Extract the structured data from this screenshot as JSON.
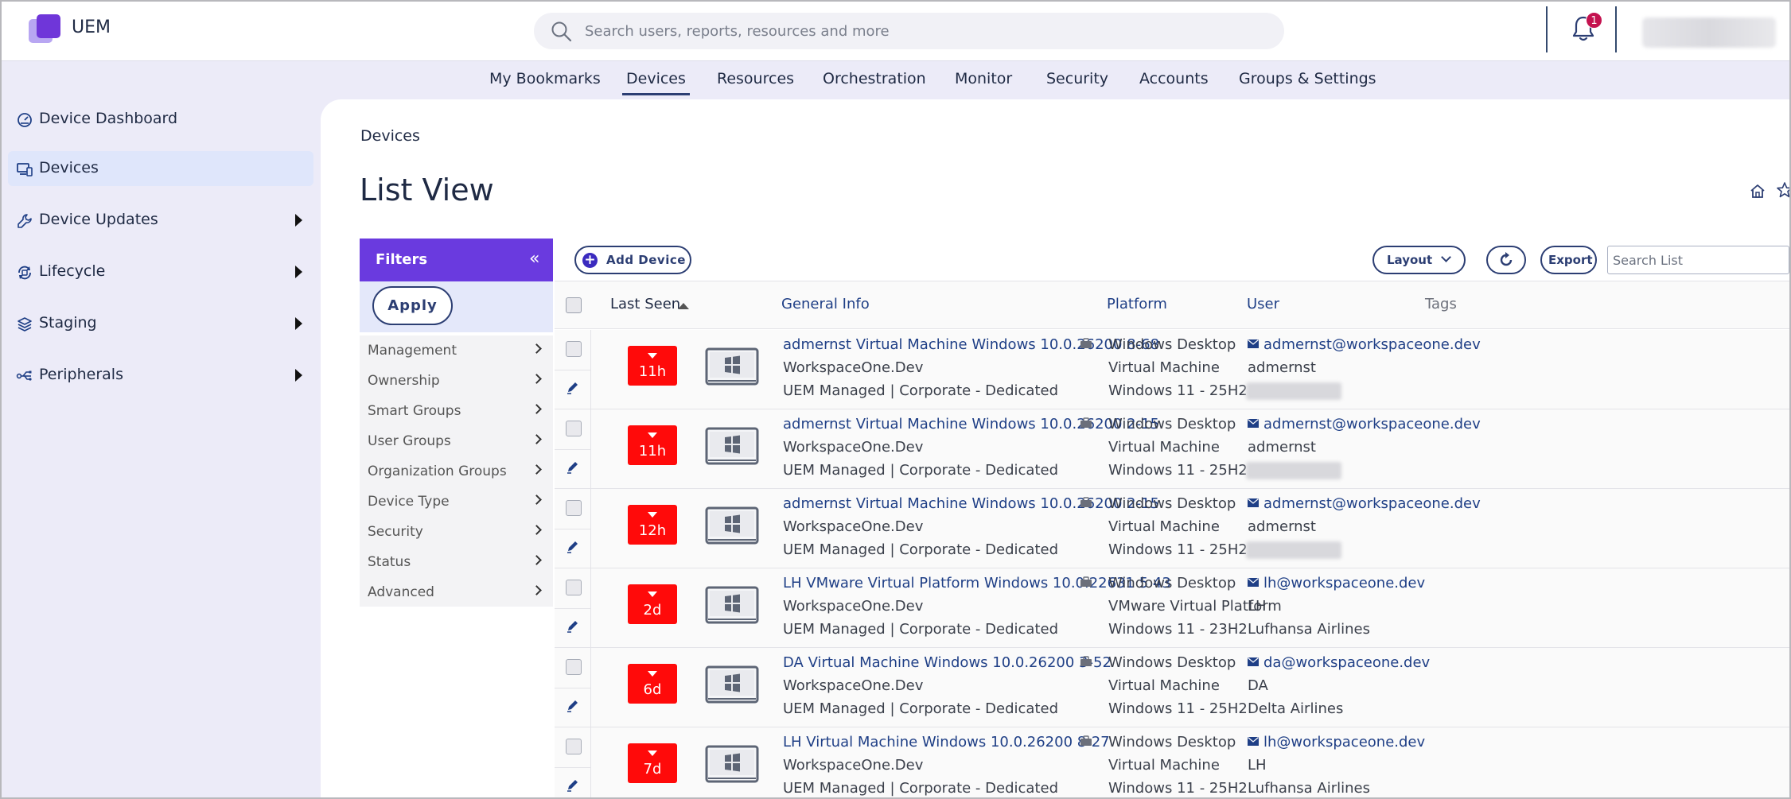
{
  "app": {
    "name": "UEM",
    "brand_color": "#6a3adf"
  },
  "search": {
    "placeholder": "Search users, reports, resources and more",
    "icon": "search-icon"
  },
  "notifications": {
    "count": "1"
  },
  "nav": {
    "items": [
      {
        "label": "My Bookmarks",
        "active": false
      },
      {
        "label": "Devices",
        "active": true
      },
      {
        "label": "Resources",
        "active": false
      },
      {
        "label": "Orchestration",
        "active": false
      },
      {
        "label": "Monitor",
        "active": false
      },
      {
        "label": "Security",
        "active": false
      },
      {
        "label": "Accounts",
        "active": false
      },
      {
        "label": "Groups & Settings",
        "active": false
      }
    ]
  },
  "sidebar": {
    "items": [
      {
        "label": "Device Dashboard",
        "icon": "dashboard-icon",
        "active": false,
        "expandable": false
      },
      {
        "label": "Devices",
        "icon": "devices-icon",
        "active": true,
        "expandable": false
      },
      {
        "label": "Device Updates",
        "icon": "wrench-icon",
        "active": false,
        "expandable": true
      },
      {
        "label": "Lifecycle",
        "icon": "lifecycle-icon",
        "active": false,
        "expandable": true
      },
      {
        "label": "Staging",
        "icon": "layers-icon",
        "active": false,
        "expandable": true
      },
      {
        "label": "Peripherals",
        "icon": "peripherals-icon",
        "active": false,
        "expandable": true
      }
    ]
  },
  "page": {
    "breadcrumb": "Devices",
    "title": "List View"
  },
  "filters": {
    "title": "Filters",
    "apply_label": "Apply",
    "items": [
      "Management",
      "Ownership",
      "Smart Groups",
      "User Groups",
      "Organization Groups",
      "Device Type",
      "Security",
      "Status",
      "Advanced"
    ]
  },
  "toolbar": {
    "add_device_label": "Add Device",
    "layout_label": "Layout",
    "export_label": "Export",
    "search_placeholder": "Search List"
  },
  "table": {
    "columns": {
      "last_seen": "Last Seen",
      "general_info": "General Info",
      "platform": "Platform",
      "user": "User",
      "tags": "Tags"
    },
    "status_color": "#ff0a0a",
    "rows": [
      {
        "last_seen": "11h",
        "title": "admernst Virtual Machine Windows 10.0.26200 8-68",
        "org": "WorkspaceOne.Dev",
        "management": "UEM Managed | Corporate - Dedicated",
        "platform": [
          "Windows Desktop",
          "Virtual Machine",
          "Windows 11 - 25H2"
        ],
        "email": "admernst@workspaceone.dev",
        "username": "admernst",
        "user_org": ""
      },
      {
        "last_seen": "11h",
        "title": "admernst Virtual Machine Windows 10.0.26200 2-15",
        "org": "WorkspaceOne.Dev",
        "management": "UEM Managed | Corporate - Dedicated",
        "platform": [
          "Windows Desktop",
          "Virtual Machine",
          "Windows 11 - 25H2"
        ],
        "email": "admernst@workspaceone.dev",
        "username": "admernst",
        "user_org": ""
      },
      {
        "last_seen": "12h",
        "title": "admernst Virtual Machine Windows 10.0.26200 2-15",
        "org": "WorkspaceOne.Dev",
        "management": "UEM Managed | Corporate - Dedicated",
        "platform": [
          "Windows Desktop",
          "Virtual Machine",
          "Windows 11 - 25H2"
        ],
        "email": "admernst@workspaceone.dev",
        "username": "admernst",
        "user_org": ""
      },
      {
        "last_seen": "2d",
        "title": "LH VMware Virtual Platform Windows 10.0.22631 5 43",
        "org": "WorkspaceOne.Dev",
        "management": "UEM Managed | Corporate - Dedicated",
        "platform": [
          "Windows Desktop",
          "VMware Virtual Platform",
          "Windows 11 - 23H2"
        ],
        "email": "lh@workspaceone.dev",
        "username": "LH",
        "user_org": "Lufhansa Airlines"
      },
      {
        "last_seen": "6d",
        "title": "DA Virtual Machine Windows 10.0.26200 3-52",
        "org": "WorkspaceOne.Dev",
        "management": "UEM Managed | Corporate - Dedicated",
        "platform": [
          "Windows Desktop",
          "Virtual Machine",
          "Windows 11 - 25H2"
        ],
        "email": "da@workspaceone.dev",
        "username": "DA",
        "user_org": "Delta Airlines"
      },
      {
        "last_seen": "7d",
        "title": "LH Virtual Machine Windows 10.0.26200 8-27",
        "org": "WorkspaceOne.Dev",
        "management": "UEM Managed | Corporate - Dedicated",
        "platform": [
          "Windows Desktop",
          "Virtual Machine",
          "Windows 11 - 25H2"
        ],
        "email": "lh@workspaceone.dev",
        "username": "LH",
        "user_org": "Lufhansa Airlines"
      }
    ]
  }
}
